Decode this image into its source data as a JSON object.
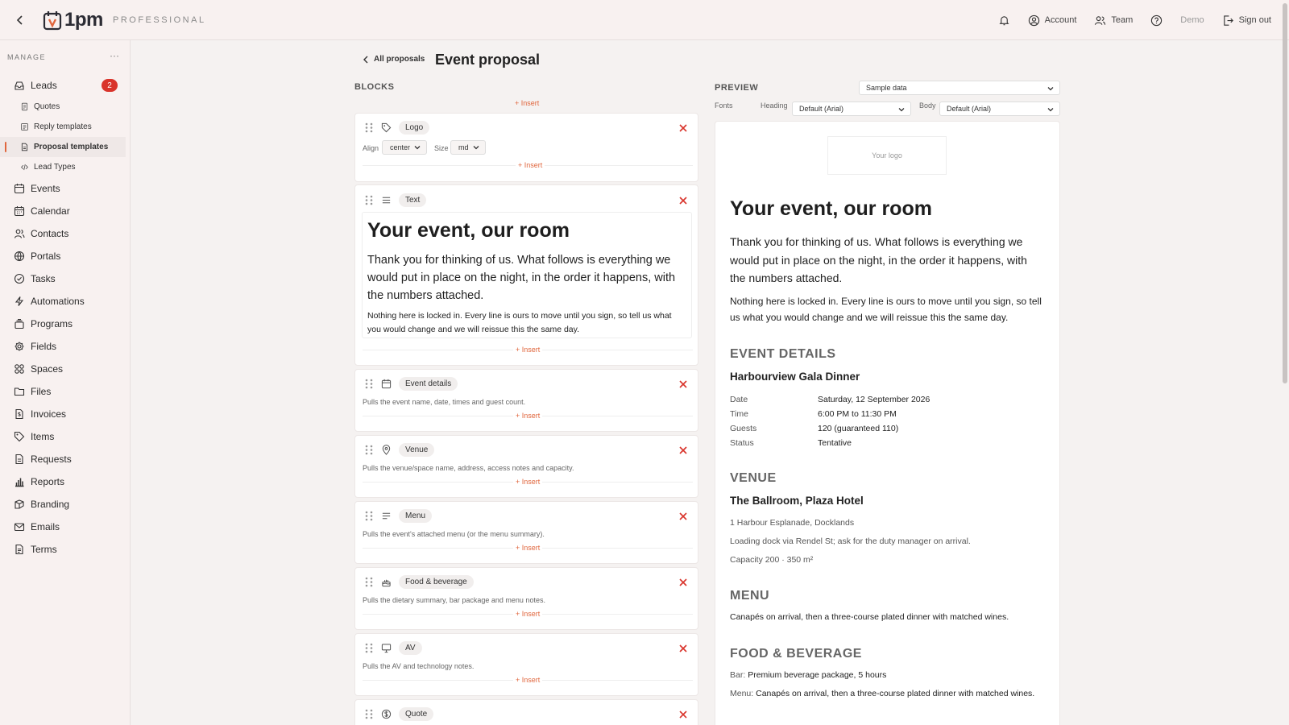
{
  "topbar": {
    "brand": "1pm",
    "plan": "PROFESSIONAL",
    "account": "Account",
    "team": "Team",
    "demo": "Demo",
    "signout": "Sign out"
  },
  "sidebar": {
    "heading": "MANAGE",
    "more": "···",
    "items": [
      {
        "label": "Leads",
        "icon": "inbox-icon",
        "badge": "2"
      },
      {
        "label": "Quotes",
        "icon": "quote-doc-icon",
        "sub": true
      },
      {
        "label": "Reply templates",
        "icon": "template-icon",
        "sub": true
      },
      {
        "label": "Proposal templates",
        "icon": "proposal-doc-icon",
        "sub": true,
        "active": true
      },
      {
        "label": "Lead Types",
        "icon": "code-icon",
        "sub": true
      },
      {
        "label": "Events",
        "icon": "calendar-icon"
      },
      {
        "label": "Calendar",
        "icon": "calendar-grid-icon"
      },
      {
        "label": "Contacts",
        "icon": "contacts-icon"
      },
      {
        "label": "Portals",
        "icon": "globe-icon"
      },
      {
        "label": "Tasks",
        "icon": "check-circle-icon"
      },
      {
        "label": "Automations",
        "icon": "lightning-icon"
      },
      {
        "label": "Programs",
        "icon": "layers-icon"
      },
      {
        "label": "Fields",
        "icon": "gear-icon"
      },
      {
        "label": "Spaces",
        "icon": "grid-icon"
      },
      {
        "label": "Files",
        "icon": "folder-icon"
      },
      {
        "label": "Invoices",
        "icon": "invoice-icon"
      },
      {
        "label": "Items",
        "icon": "tag-icon"
      },
      {
        "label": "Requests",
        "icon": "request-doc-icon"
      },
      {
        "label": "Reports",
        "icon": "bar-chart-icon"
      },
      {
        "label": "Branding",
        "icon": "palette-icon"
      },
      {
        "label": "Emails",
        "icon": "mail-icon"
      },
      {
        "label": "Terms",
        "icon": "terms-doc-icon"
      }
    ]
  },
  "header": {
    "back_label": "All proposals",
    "title": "Event proposal"
  },
  "blocks": {
    "heading": "BLOCKS",
    "insert_label": "+ Insert",
    "logo": {
      "chip": "Logo",
      "align_label": "Align",
      "align_value": "center",
      "size_label": "Size",
      "size_value": "md"
    },
    "text": {
      "chip": "Text",
      "heading": "Your event, our room",
      "para1": "Thank you for thinking of us. What follows is everything we would put in place on the night, in the order it happens, with the numbers attached.",
      "para2": "Nothing here is locked in. Every line is ours to move until you sign, so tell us what you would change and we will reissue this the same day."
    },
    "event_details": {
      "chip": "Event details",
      "desc": "Pulls the event name, date, times and guest count."
    },
    "venue": {
      "chip": "Venue",
      "desc": "Pulls the venue/space name, address, access notes and capacity."
    },
    "menu": {
      "chip": "Menu",
      "desc": "Pulls the event's attached menu (or the menu summary)."
    },
    "food": {
      "chip": "Food & beverage",
      "desc": "Pulls the dietary summary, bar package and menu notes."
    },
    "av": {
      "chip": "AV",
      "desc": "Pulls the AV and technology notes."
    },
    "quote": {
      "chip": "Quote"
    }
  },
  "preview": {
    "heading": "PREVIEW",
    "sample_select": "Sample data",
    "fonts_label": "Fonts",
    "heading_label": "Heading",
    "heading_font": "Default (Arial)",
    "body_label": "Body",
    "body_font": "Default (Arial)",
    "logo_placeholder": "Your logo",
    "title": "Your event, our room",
    "para1": "Thank you for thinking of us. What follows is everything we would put in place on the night, in the order it happens, with the numbers attached.",
    "para2": "Nothing here is locked in. Every line is ours to move until you sign, so tell us what you would change and we will reissue this the same day.",
    "event_section": "EVENT DETAILS",
    "event_name": "Harbourview Gala Dinner",
    "details": [
      {
        "label": "Date",
        "value": "Saturday, 12 September 2026"
      },
      {
        "label": "Time",
        "value": "6:00 PM to 11:30 PM"
      },
      {
        "label": "Guests",
        "value": "120 (guaranteed 110)"
      },
      {
        "label": "Status",
        "value": "Tentative"
      }
    ],
    "venue_section": "VENUE",
    "venue_name": "The Ballroom, Plaza Hotel",
    "venue_address": "1 Harbour Esplanade, Docklands",
    "venue_access": "Loading dock via Rendel St; ask for the duty manager on arrival.",
    "venue_capacity": "Capacity 200 · 350 m²",
    "menu_section": "MENU",
    "menu_text": "Canapés on arrival, then a three-course plated dinner with matched wines.",
    "food_section": "FOOD & BEVERAGE",
    "bar_label": "Bar:",
    "bar_value": "Premium beverage package, 5 hours",
    "menu_label": "Menu:",
    "menu_value": "Canapés on arrival, then a three-course plated dinner with matched wines."
  },
  "colors": {
    "accent": "#e0663d",
    "badge": "#d9342b",
    "remove": "#d9342b"
  }
}
